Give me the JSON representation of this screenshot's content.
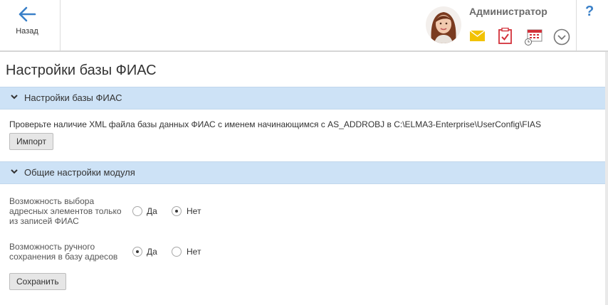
{
  "header": {
    "back_label": "Назад",
    "user_name": "Администратор",
    "help_label": "?",
    "icons": [
      "back-arrow-icon",
      "mail-icon",
      "tasks-checklist-icon",
      "calendar-icon",
      "dropdown-circle-icon"
    ]
  },
  "colors": {
    "accent": "#3a80c8",
    "section_bg": "#cde2f6",
    "mail": "#f2c200",
    "task_red": "#d3313a"
  },
  "page": {
    "title": "Настройки базы ФИАС"
  },
  "section1": {
    "title": "Настройки базы ФИАС",
    "info": "Проверьте наличие XML файла базы данных ФИАС с именем начинающимся с AS_ADDROBJ в C:\\ELMA3-Enterprise\\UserConfig\\FIAS",
    "import_label": "Импорт"
  },
  "section2": {
    "title": "Общие настройки модуля",
    "options": [
      {
        "label_lines": [
          "Возможность выбора",
          "адресных элементов только",
          "из записей ФИАС"
        ],
        "yes": "Да",
        "no": "Нет",
        "selected": "no"
      },
      {
        "label_lines": [
          "Возможность ручного",
          "сохранения в базу адресов"
        ],
        "yes": "Да",
        "no": "Нет",
        "selected": "yes"
      }
    ],
    "save_label": "Сохранить"
  }
}
